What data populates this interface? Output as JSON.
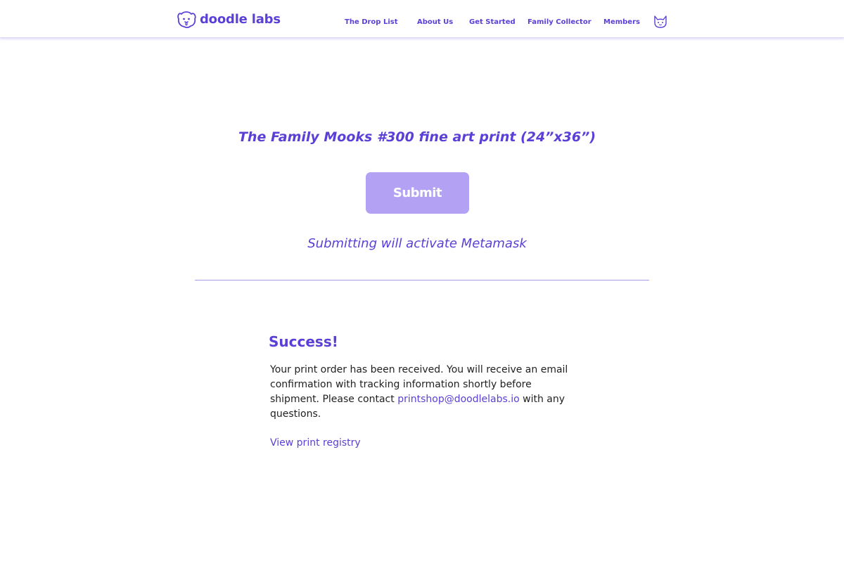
{
  "header": {
    "brand": "doodle labs",
    "nav": [
      {
        "label": "The Drop List"
      },
      {
        "label": "About Us"
      },
      {
        "label": "Get Started"
      },
      {
        "label": "Family Collector"
      },
      {
        "label": "Members"
      }
    ],
    "account_icon": "doodle-cat-face-icon",
    "brand_icon": "doodle-dog-face-icon"
  },
  "product": {
    "title": "The Family Mooks #300 fine art print (24”x36”)"
  },
  "submit": {
    "label": "Submit",
    "note": "Submitting will activate Metamask"
  },
  "success": {
    "heading": "Success!",
    "body_before": "Your print order has been received. You will receive an email confirmation with tracking information shortly before shipment. Please contact ",
    "email": "printshop@doodlelabs.io",
    "body_after": " with any questions.",
    "registry_link": "View print registry"
  },
  "colors": {
    "accent": "#5b3fd6",
    "button": "#b3a2f3",
    "divider": "#a99ae6",
    "text": "#1f1f1f"
  }
}
